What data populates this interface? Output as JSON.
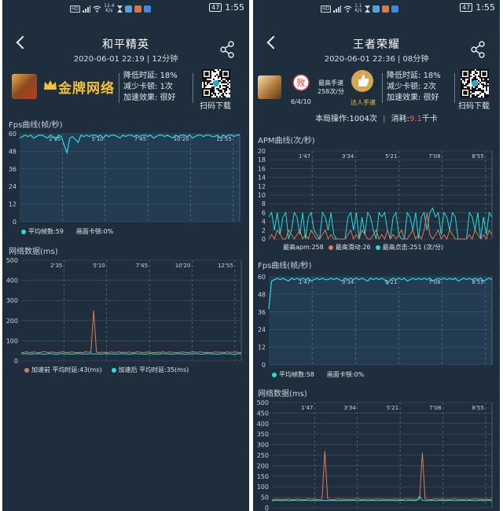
{
  "left": {
    "status": {
      "hd": "HD",
      "speed_value": "12.4",
      "speed_unit": "K/s",
      "battery": "47",
      "time": "1:55"
    },
    "title": "和平精英",
    "subtitle": "2020-06-01 22:19 | 12分钟",
    "badge": "金牌网络",
    "stats": [
      {
        "label": "降低时延:",
        "value": "18%"
      },
      {
        "label": "减少卡顿:",
        "value": "1次"
      },
      {
        "label": "加速效果:",
        "value": "很好"
      }
    ],
    "qr_label": "扫码下载",
    "fps_section": "Fps曲线(帧/秒)",
    "fps_legend": {
      "avg": "平均帧数:59",
      "stutter": "画面卡顿:0%"
    },
    "net_section": "网络数据(ms)",
    "net_legend": {
      "before": "加速前  平均时延:43(ms)",
      "after": "加速后  平均时延:35(ms)"
    }
  },
  "right": {
    "status": {
      "hd": "HD",
      "speed_value": "1.1",
      "speed_unit": "K/s",
      "battery": "47",
      "time": "1:55"
    },
    "title": "王者荣耀",
    "subtitle": "2020-06-01 22:36 | 08分钟",
    "kda": "6/4/10",
    "fast_label": "最高手速",
    "fast_value": "258次/分",
    "master_label": "达人手速",
    "stats": [
      {
        "label": "降低时延:",
        "value": "18%"
      },
      {
        "label": "减少卡顿:",
        "value": "2次"
      },
      {
        "label": "加速效果:",
        "value": "很好"
      }
    ],
    "qr_label": "扫码下载",
    "ops_text": "本局操作:1004次",
    "consume_prefix": "消耗:",
    "consume_value": "9.1",
    "consume_unit": "千卡",
    "apm_section": "APM曲线(次/秒)",
    "apm_legend": {
      "apm": "最高apm:258",
      "slide": "最高滑动:26",
      "click": "最高点击:251 (次/分)"
    },
    "fps_section": "Fps曲线(帧/秒)",
    "fps_legend": {
      "avg": "平均帧数:58",
      "stutter": "画面卡顿:0%"
    },
    "net_section": "网络数据(ms)"
  },
  "colors": {
    "panel_bg": "#1e2e3c",
    "plot_bg": "#243c52",
    "cyan": "#1ee0e0",
    "orange": "#e07a52",
    "gold": "#f2c230",
    "red": "#ff5a5a"
  },
  "chart_data": [
    {
      "type": "line",
      "title": "Fps曲线(帧/秒)",
      "x_ticks": [
        "2'35",
        "5'10",
        "7'45",
        "10'20",
        "12'55"
      ],
      "y_ticks": [
        0,
        12,
        24,
        36,
        48,
        60
      ],
      "ylim": [
        0,
        60
      ],
      "series": [
        {
          "name": "平均帧数",
          "values": [
            57,
            58,
            59,
            58,
            59,
            57,
            58,
            59,
            59,
            58,
            57,
            59,
            58,
            56,
            59,
            58,
            52,
            47,
            57,
            58,
            56,
            54,
            59,
            58,
            59,
            58,
            59,
            59,
            58,
            59,
            57,
            59,
            58,
            59,
            59,
            58,
            57,
            59,
            58,
            59,
            59,
            58,
            59,
            58,
            59,
            59,
            58,
            59,
            57,
            58,
            59,
            59,
            58,
            59,
            58,
            57,
            59,
            58,
            59,
            59,
            58,
            59,
            57,
            58,
            59,
            59,
            58,
            59,
            59,
            58,
            58,
            59,
            57,
            59,
            58,
            59,
            59,
            58,
            59,
            59
          ]
        }
      ]
    },
    {
      "type": "line",
      "title": "网络数据(ms)",
      "x_ticks": [
        "2'35",
        "5'10",
        "7'45",
        "10'20",
        "12'55"
      ],
      "y_ticks": [
        0,
        100,
        200,
        300,
        400,
        500
      ],
      "ylim": [
        0,
        500
      ],
      "series": [
        {
          "name": "加速前",
          "values": [
            40,
            42,
            45,
            41,
            43,
            44,
            40,
            42,
            46,
            43,
            41,
            44,
            42,
            40,
            43,
            45,
            41,
            42,
            44,
            43,
            40,
            42,
            41,
            45,
            43,
            42,
            250,
            44,
            41,
            43,
            42,
            40,
            44,
            43,
            42,
            45,
            41,
            43,
            42,
            44,
            40,
            43,
            45,
            42,
            41,
            44,
            43,
            42,
            40,
            43,
            42,
            45,
            41,
            44,
            43,
            42,
            40,
            43,
            44,
            42,
            41,
            43,
            45,
            42,
            44,
            43,
            41,
            42,
            40,
            43,
            44,
            42,
            43,
            41,
            45,
            42,
            43,
            44,
            42,
            41
          ]
        },
        {
          "name": "加速后",
          "values": [
            34,
            35,
            36,
            33,
            35,
            34,
            36,
            35,
            33,
            34,
            36,
            35,
            34,
            33,
            35,
            36,
            34,
            35,
            33,
            34,
            36,
            35,
            34,
            35,
            33,
            36,
            34,
            35,
            34,
            33,
            36,
            35,
            34,
            35,
            33,
            34,
            36,
            35,
            34,
            33,
            35,
            36,
            34,
            35,
            33,
            34,
            36,
            35,
            34,
            33,
            35,
            36,
            34,
            35,
            33,
            34,
            36,
            35,
            34,
            33,
            35,
            34,
            36,
            35,
            34,
            33,
            35,
            36,
            34,
            35,
            33,
            34,
            35,
            36,
            34,
            35,
            33,
            34,
            36,
            35
          ]
        }
      ]
    },
    {
      "type": "line",
      "title": "APM曲线(次/秒)",
      "x_ticks": [
        "1'47",
        "3'34",
        "5'21",
        "7'08",
        "8'55"
      ],
      "y_ticks": [
        0,
        2,
        4,
        6,
        8,
        10,
        12,
        14,
        16,
        18,
        20
      ],
      "ylim": [
        0,
        20
      ],
      "series": [
        {
          "name": "点击",
          "values": [
            5,
            6,
            2,
            6,
            1,
            5,
            6,
            0,
            2,
            6,
            5,
            1,
            6,
            0,
            5,
            6,
            2,
            1,
            0,
            6,
            5,
            2,
            6,
            1,
            0,
            0,
            0,
            0,
            5,
            6,
            2,
            6,
            0,
            5,
            1,
            6,
            5,
            2,
            0,
            6,
            5,
            6,
            2,
            0,
            5,
            6,
            1,
            0,
            0,
            6,
            5,
            2,
            6,
            0,
            5,
            6,
            2,
            6,
            7,
            5,
            6,
            1,
            6,
            5,
            2,
            6,
            5,
            0,
            0,
            0,
            0,
            6,
            5,
            2,
            6,
            0,
            5,
            1,
            6,
            5
          ]
        },
        {
          "name": "滑动",
          "values": [
            0,
            1,
            0,
            2,
            1,
            0,
            0,
            2,
            1,
            0,
            1,
            2,
            0,
            1,
            0,
            2,
            1,
            0,
            0,
            1,
            2,
            0,
            1,
            0,
            0,
            0,
            0,
            0,
            1,
            2,
            0,
            1,
            0,
            2,
            1,
            0,
            0,
            1,
            2,
            0,
            1,
            0,
            2,
            0,
            1,
            0,
            1,
            2,
            0,
            0,
            1,
            2,
            0,
            1,
            0,
            2,
            6,
            1,
            0,
            1,
            2,
            0,
            1,
            0,
            2,
            1,
            0,
            0,
            0,
            0,
            0,
            1,
            0,
            2,
            1,
            0,
            1,
            0,
            2,
            1
          ]
        }
      ]
    },
    {
      "type": "line",
      "title": "Fps曲线(帧/秒)",
      "x_ticks": [
        "1'47",
        "3'34",
        "5'21",
        "7'08",
        "8'55"
      ],
      "y_ticks": [
        0,
        12,
        24,
        36,
        48,
        60
      ],
      "ylim": [
        0,
        60
      ],
      "series": [
        {
          "name": "平均帧数",
          "values": [
            38,
            57,
            58,
            59,
            58,
            59,
            58,
            57,
            59,
            58,
            59,
            58,
            59,
            58,
            59,
            57,
            58,
            59,
            58,
            59,
            58,
            58,
            59,
            58,
            59,
            58,
            57,
            59,
            58,
            59,
            58,
            59,
            58,
            59,
            58,
            57,
            59,
            58,
            59,
            58,
            59,
            58,
            55,
            58,
            59,
            58,
            59,
            58,
            59,
            57,
            58,
            59,
            58,
            59,
            58,
            59,
            58,
            59,
            57,
            58,
            59,
            58,
            59,
            58,
            59,
            58,
            59,
            57,
            58,
            59,
            58,
            59,
            58,
            59,
            58,
            59,
            57,
            58,
            59,
            58
          ]
        }
      ]
    },
    {
      "type": "line",
      "title": "网络数据(ms)",
      "x_ticks": [
        "1'47",
        "3'34",
        "5'21",
        "7'08",
        "8'55"
      ],
      "y_ticks": [
        0,
        50,
        100,
        150,
        200,
        250,
        300,
        350,
        400,
        450,
        500
      ],
      "series": [
        {
          "name": "加速前",
          "values": [
            38,
            40,
            42,
            39,
            41,
            40,
            43,
            39,
            40,
            42,
            41,
            39,
            40,
            43,
            41,
            42,
            40,
            39,
            41,
            270,
            42,
            40,
            39,
            41,
            43,
            40,
            42,
            39,
            41,
            40,
            42,
            43,
            39,
            41,
            40,
            42,
            39,
            41,
            43,
            40,
            42,
            39,
            41,
            40,
            42,
            41,
            39,
            40,
            43,
            41,
            42,
            40,
            39,
            41,
            262,
            42,
            40,
            39,
            41,
            43,
            40,
            42,
            39,
            41,
            40,
            42,
            43,
            39,
            41,
            40,
            42,
            39,
            41,
            43,
            40,
            42,
            39,
            41,
            40,
            42
          ]
        },
        {
          "name": "加速后",
          "values": [
            34,
            35,
            36,
            34,
            35,
            36,
            34,
            35,
            36,
            34,
            35,
            34,
            36,
            35,
            34,
            36,
            35,
            34,
            35,
            36,
            34,
            35,
            36,
            34,
            35,
            34,
            36,
            35,
            34,
            36,
            35,
            34,
            35,
            36,
            34,
            35,
            36,
            34,
            35,
            34,
            36,
            35,
            34,
            36,
            35,
            34,
            35,
            36,
            34,
            35,
            36,
            34,
            35,
            55,
            36,
            35,
            34,
            36,
            35,
            34,
            35,
            36,
            34,
            35,
            36,
            34,
            35,
            34,
            36,
            35,
            34,
            36,
            35,
            34,
            35,
            36,
            34,
            35,
            36,
            34
          ]
        }
      ]
    }
  ]
}
